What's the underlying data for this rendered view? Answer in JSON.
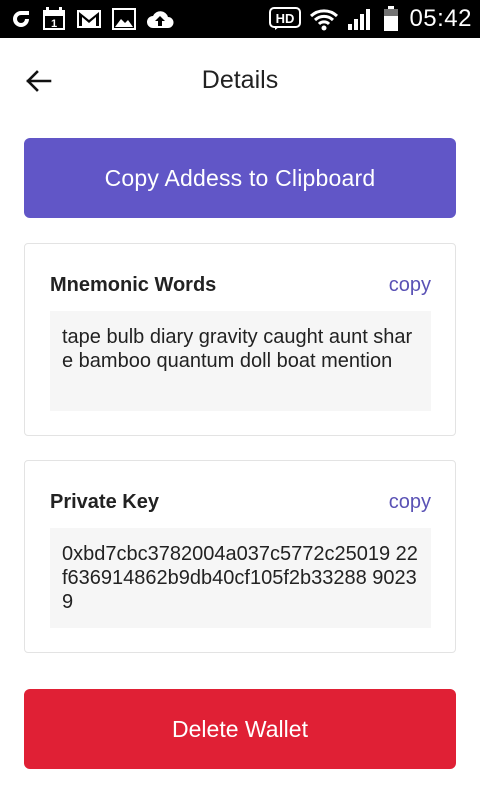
{
  "status_bar": {
    "time": "05:42",
    "hd_label": "HD",
    "icons": [
      "sync-icon",
      "calendar-icon",
      "gmail-icon",
      "gallery-icon",
      "cloud-upload-icon",
      "hd-icon",
      "wifi-icon",
      "signal-icon",
      "battery-icon"
    ]
  },
  "header": {
    "title": "Details",
    "back_icon": "arrow-left-icon"
  },
  "copy_address_button": {
    "label": "Copy Addess to Clipboard",
    "color": "#6156c7"
  },
  "mnemonic": {
    "title": "Mnemonic Words",
    "copy_label": "copy",
    "value": "tape bulb diary gravity caught aunt share bamboo quantum doll boat mention"
  },
  "private_key": {
    "title": "Private Key",
    "copy_label": "copy",
    "value": "0xbd7cbc3782004a037c5772c25019 22f636914862b9db40cf105f2b33288 90239"
  },
  "delete_button": {
    "label": "Delete Wallet",
    "color": "#e02035"
  },
  "colors": {
    "accent": "#6156c7",
    "link": "#5a52b5",
    "danger": "#e02035",
    "field_bg": "#f6f6f6"
  }
}
